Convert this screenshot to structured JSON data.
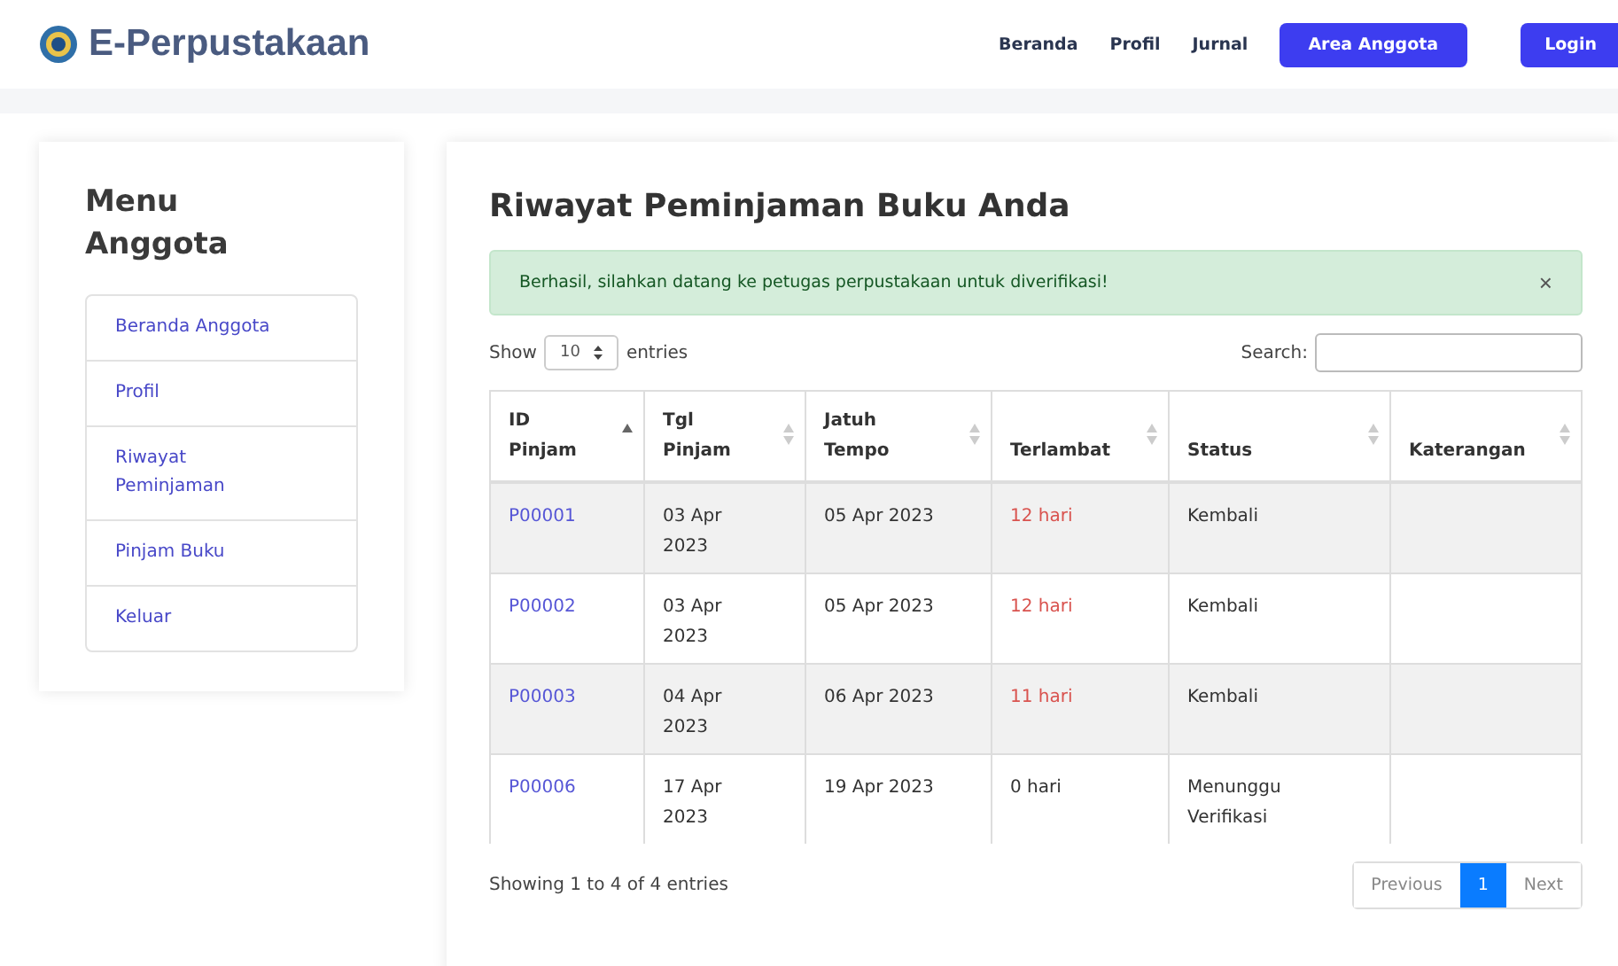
{
  "navbar": {
    "brand": "E-Perpustakaan",
    "links": [
      {
        "label": "Beranda",
        "kind": "link"
      },
      {
        "label": "Profil",
        "kind": "link"
      },
      {
        "label": "Jurnal",
        "kind": "link"
      },
      {
        "label": "Area Anggota",
        "kind": "button"
      },
      {
        "label": "Login",
        "kind": "button"
      }
    ]
  },
  "sidebar": {
    "title": "Menu Anggota",
    "items": [
      {
        "label": "Beranda Anggota",
        "selected": false
      },
      {
        "label": "Profil",
        "selected": false
      },
      {
        "label": "Riwayat Peminjaman",
        "selected": false
      },
      {
        "label": "Pinjam Buku",
        "selected": false
      },
      {
        "label": "Keluar",
        "selected": false
      }
    ]
  },
  "main": {
    "title": "Riwayat Peminjaman Buku Anda",
    "alert": {
      "message": "Berhasil, silahkan datang ke petugas perpustakaan untuk diverifikasi!",
      "close": "×"
    },
    "length": {
      "before": "Show",
      "value": "10",
      "after": "entries"
    },
    "search": {
      "label": "Search:"
    },
    "table": {
      "columns": [
        {
          "label": "ID Pinjam",
          "sorted": true
        },
        {
          "label": "Tgl Pinjam",
          "sorted": false
        },
        {
          "label": "Jatuh Tempo",
          "sorted": false
        },
        {
          "label": "Terlambat",
          "sorted": false
        },
        {
          "label": "Status",
          "sorted": false
        },
        {
          "label": "Katerangan",
          "sorted": false
        }
      ],
      "rows": [
        {
          "id": "P00001",
          "tgl_pinjam": "03 Apr 2023",
          "jatuh_tempo": "05 Apr 2023",
          "terlambat": "12 hari",
          "late": true,
          "status": "Kembali"
        },
        {
          "id": "P00002",
          "tgl_pinjam": "03 Apr 2023",
          "jatuh_tempo": "05 Apr 2023",
          "terlambat": "12 hari",
          "late": true,
          "status": "Kembali"
        },
        {
          "id": "P00003",
          "tgl_pinjam": "04 Apr 2023",
          "jatuh_tempo": "06 Apr 2023",
          "terlambat": "11 hari",
          "late": true,
          "status": "Kembali"
        },
        {
          "id": "P00006",
          "tgl_pinjam": "17 Apr 2023",
          "jatuh_tempo": "19 Apr 2023",
          "terlambat": "0 hari",
          "late": false,
          "status": "Menunggu Verifikasi"
        }
      ]
    },
    "info": "Showing 1 to 4 of 4 entries",
    "pagination": [
      {
        "label": "Previous",
        "disabled": true,
        "selected": false
      },
      {
        "label": "1",
        "disabled": false,
        "selected": true
      },
      {
        "label": "Next",
        "disabled": true,
        "selected": false
      }
    ]
  }
}
